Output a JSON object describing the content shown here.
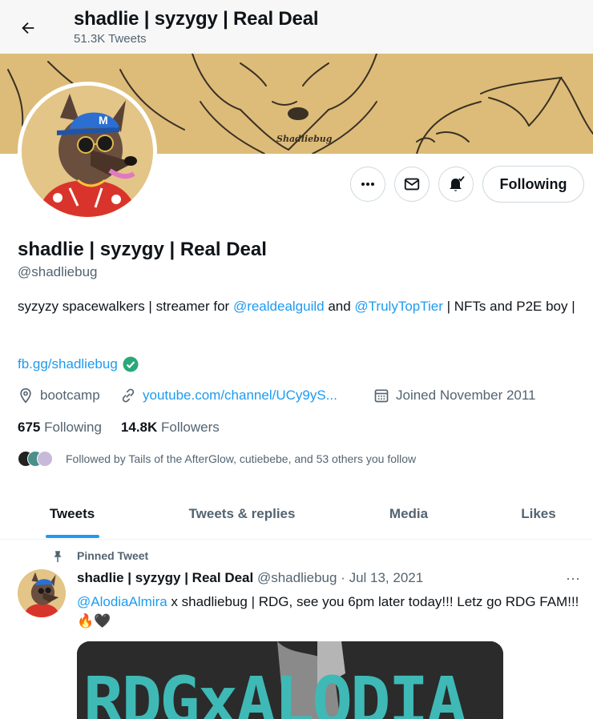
{
  "header": {
    "title": "shadlie | syzygy | Real Deal",
    "tweet_count": "51.3K Tweets"
  },
  "banner": {
    "signature": "Shadliebug"
  },
  "actions": {
    "following_label": "Following"
  },
  "profile": {
    "name": "shadlie | syzygy | Real Deal",
    "handle": "@shadliebug",
    "bio": {
      "part1": "syzyzy spacewalkers | streamer for ",
      "mention1": "@realdealguild",
      "part2": " and ",
      "mention2": "@TrulyTopTier",
      "part3": " | NFTs and P2E boy |"
    },
    "fb_link": "fb.gg/shadliebug",
    "location": "bootcamp",
    "website": "youtube.com/channel/UCy9yS...",
    "joined": "Joined November 2011",
    "following_count": "675",
    "following_label": "Following",
    "followers_count": "14.8K",
    "followers_label": "Followers",
    "followed_by": "Followed by Tails of the AfterGlow, cutiebebe, and 53 others you follow"
  },
  "tabs": [
    "Tweets",
    "Tweets & replies",
    "Media",
    "Likes"
  ],
  "tweet": {
    "pinned_label": "Pinned Tweet",
    "author_name": "shadlie | syzygy | Real Deal",
    "author_handle_date": "@shadliebug · Jul 13, 2021",
    "more": "···",
    "mention": "@AlodiaAlmira",
    "text": " x shadliebug | RDG, see you 6pm later today!!! Letz go RDG FAM!!! 🔥🖤",
    "media_text": "RDGxALODIA"
  },
  "colors": {
    "accent": "#1d9bf0",
    "banner": "#dcbc78",
    "verified": "#2aa87a",
    "media_teal": "#3fb9b5"
  }
}
